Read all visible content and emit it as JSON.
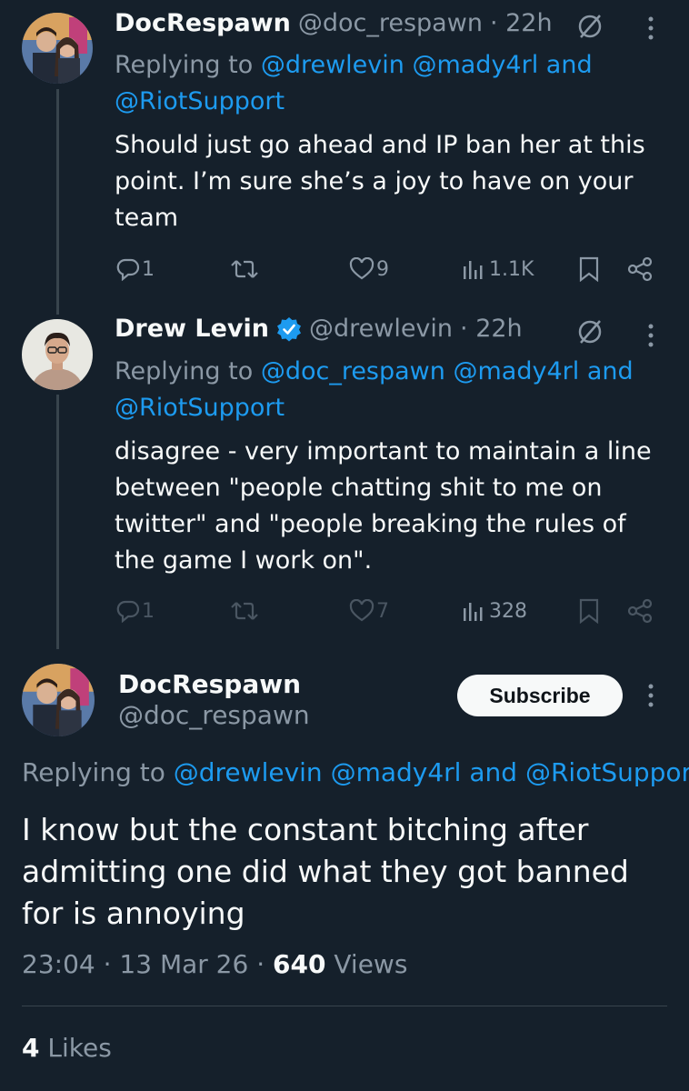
{
  "tweet1": {
    "name": "DocRespawn",
    "handle": "@doc_respawn",
    "time": "· 22h",
    "replying_prefix": "Replying to",
    "reply_user1": "@drewlevin",
    "reply_user2": "@mady4rl",
    "and_text": "and",
    "reply_user3": "@RiotSupport",
    "body": "Should just go ahead and IP ban her at this point. I’m sure she’s a joy to have on your team",
    "replies": "1",
    "retweets": "",
    "likes": "9",
    "views": "1.1K"
  },
  "tweet2": {
    "name": "Drew Levin",
    "handle": "@drewlevin",
    "time": "· 22h",
    "replying_prefix": "Replying to",
    "reply_user1": "@doc_respawn",
    "reply_user2": "@mady4rl",
    "and_text": "and",
    "reply_user3": "@RiotSupport",
    "body": "disagree - very important to maintain a line between \"people chatting shit to me on twitter\" and \"people breaking the rules of the game I work on\".",
    "replies": "1",
    "likes": "7",
    "views": "328"
  },
  "main": {
    "name": "DocRespawn",
    "handle": "@doc_respawn",
    "subscribe_label": "Subscribe",
    "replying_prefix": "Replying to",
    "reply_user1": "@drewlevin",
    "reply_user2": "@mady4rl",
    "and_text": "and",
    "reply_user3": "@RiotSupport",
    "body": "I know but the constant bitching after admitting one did what they got banned for is annoying",
    "time": "23:04",
    "sep": "·",
    "date": "13 Mar 26",
    "views_count": "640",
    "views_label": "Views",
    "likes_count": "4",
    "likes_label": "Likes"
  },
  "colors": {
    "background": "#15202b",
    "link": "#1d9bf0",
    "muted": "#8b98a5",
    "verified": "#1d9bf0"
  },
  "icons": [
    "reply-icon",
    "retweet-icon",
    "like-icon",
    "views-icon",
    "bookmark-icon",
    "share-icon",
    "more-icon",
    "mute-slash-icon",
    "verified-badge-icon"
  ]
}
